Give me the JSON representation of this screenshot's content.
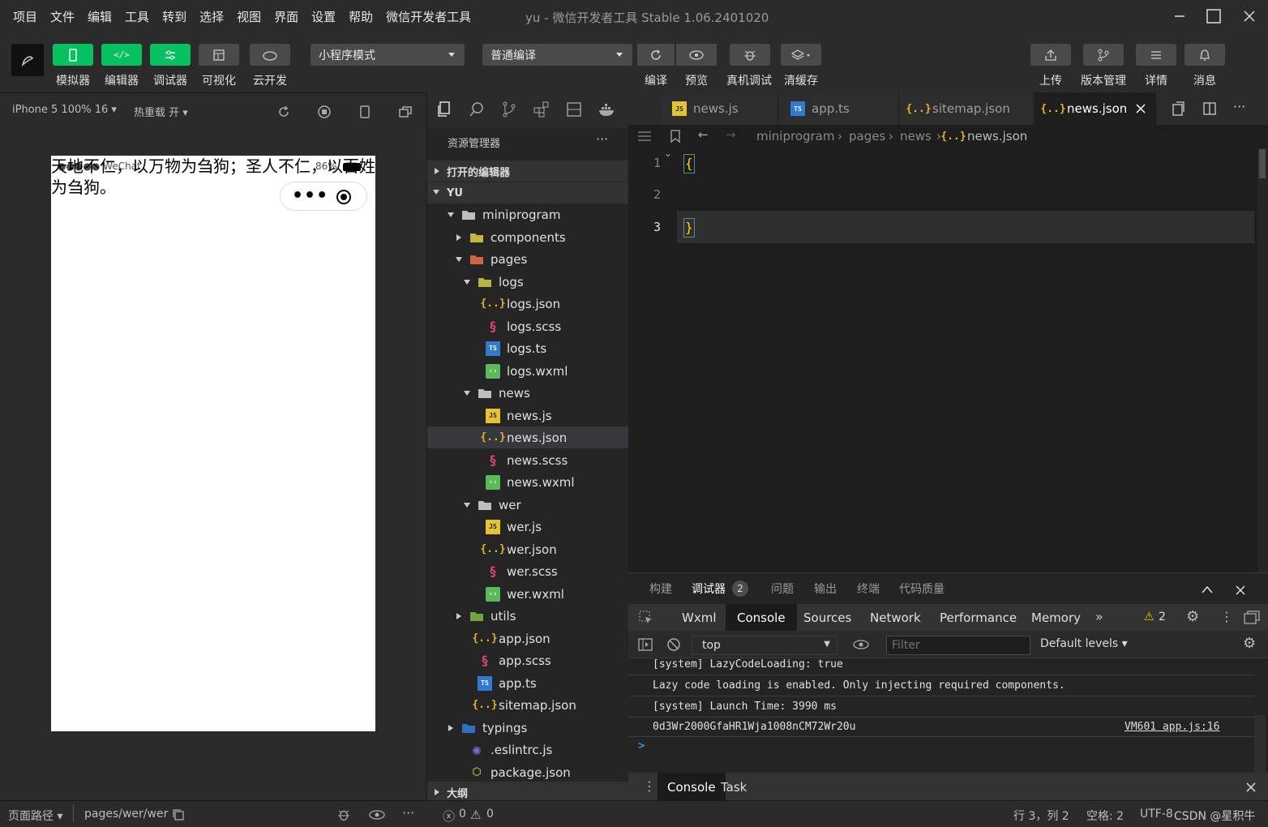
{
  "menubar": {
    "items": [
      "项目",
      "文件",
      "编辑",
      "工具",
      "转到",
      "选择",
      "视图",
      "界面",
      "设置",
      "帮助",
      "微信开发者工具"
    ],
    "window_title": "yu - 微信开发者工具 Stable 1.06.2401020"
  },
  "toolbar": {
    "simulator": "模拟器",
    "editor": "编辑器",
    "debugger": "调试器",
    "visual": "可视化",
    "cloud": "云开发",
    "mode_select": "小程序模式",
    "compile_select": "普通编译",
    "compile": "编译",
    "preview": "预览",
    "device_debug": "真机调试",
    "clear_cache": "清缓存",
    "upload": "上传",
    "version": "版本管理",
    "details": "详情",
    "messages": "消息"
  },
  "simulator": {
    "device": "iPhone 5 100% 16 ▾",
    "hot_reload": "热重载 开 ▾",
    "status_left": "●●●●● WeChat",
    "status_time": "",
    "status_battery": "86%",
    "page_text": "天地不仁，以万物为刍狗；圣人不仁，以百姓为刍狗。"
  },
  "explorer": {
    "title": "资源管理器",
    "open_editors": "打开的编辑器",
    "project": "YU",
    "outline": "大纲",
    "tree": [
      {
        "name": "miniprogram",
        "type": "folder",
        "depth": 1,
        "open": true
      },
      {
        "name": "components",
        "type": "folder-c",
        "depth": 2,
        "open": false
      },
      {
        "name": "pages",
        "type": "folder-p",
        "depth": 2,
        "open": true
      },
      {
        "name": "logs",
        "type": "folder-l",
        "depth": 3,
        "open": true
      },
      {
        "name": "logs.json",
        "type": "json",
        "depth": 4
      },
      {
        "name": "logs.scss",
        "type": "scss",
        "depth": 4
      },
      {
        "name": "logs.ts",
        "type": "ts",
        "depth": 4
      },
      {
        "name": "logs.wxml",
        "type": "wxml",
        "depth": 4
      },
      {
        "name": "news",
        "type": "folder",
        "depth": 3,
        "open": true
      },
      {
        "name": "news.js",
        "type": "js",
        "depth": 4
      },
      {
        "name": "news.json",
        "type": "json",
        "depth": 4,
        "selected": true
      },
      {
        "name": "news.scss",
        "type": "scss",
        "depth": 4
      },
      {
        "name": "news.wxml",
        "type": "wxml",
        "depth": 4
      },
      {
        "name": "wer",
        "type": "folder",
        "depth": 3,
        "open": true
      },
      {
        "name": "wer.js",
        "type": "js",
        "depth": 4
      },
      {
        "name": "wer.json",
        "type": "json",
        "depth": 4
      },
      {
        "name": "wer.scss",
        "type": "scss",
        "depth": 4
      },
      {
        "name": "wer.wxml",
        "type": "wxml",
        "depth": 4
      },
      {
        "name": "utils",
        "type": "folder-u",
        "depth": 2,
        "open": false
      },
      {
        "name": "app.json",
        "type": "json",
        "depth": 3
      },
      {
        "name": "app.scss",
        "type": "scss",
        "depth": 3
      },
      {
        "name": "app.ts",
        "type": "ts",
        "depth": 3
      },
      {
        "name": "sitemap.json",
        "type": "json",
        "depth": 3
      },
      {
        "name": "typings",
        "type": "folder-t",
        "depth": 1,
        "open": false
      },
      {
        "name": ".eslintrc.js",
        "type": "eslint",
        "depth": 2
      },
      {
        "name": "package.json",
        "type": "pkg",
        "depth": 2
      }
    ]
  },
  "editor": {
    "tabs": [
      {
        "label": "news.js",
        "type": "js"
      },
      {
        "label": "app.ts",
        "type": "ts"
      },
      {
        "label": "sitemap.json",
        "type": "json"
      },
      {
        "label": "news.json",
        "type": "json",
        "active": true
      }
    ],
    "breadcrumb": [
      "miniprogram",
      "pages",
      "news",
      "news.json"
    ],
    "lines": [
      {
        "num": "1",
        "text": "{"
      },
      {
        "num": "2",
        "text": ""
      },
      {
        "num": "3",
        "text": "}"
      }
    ]
  },
  "panel": {
    "tabs": [
      "构建",
      "调试器",
      "问题",
      "输出",
      "终端",
      "代码质量"
    ],
    "debugger_badge": "2",
    "devtools_tabs": [
      "Wxml",
      "Console",
      "Sources",
      "Network",
      "Performance",
      "Memory"
    ],
    "more": "»",
    "warnings": "2",
    "context": "top",
    "filter_placeholder": "Filter",
    "levels": "Default levels ▾",
    "logs": [
      {
        "text": "[system] LazyCodeLoading: true",
        "source": ""
      },
      {
        "text": "Lazy code loading is enabled. Only injecting required components.",
        "source": ""
      },
      {
        "text": "[system] Launch Time: 3990 ms",
        "source": ""
      },
      {
        "text": "0d3Wr2000GfaHR1Wja1008nCM72Wr20u",
        "source": "VM601 app.js:16"
      }
    ],
    "prompt": ">",
    "drawer_tabs": [
      "Console",
      "Task"
    ]
  },
  "statusbar": {
    "page_path_label": "页面路径 ▾",
    "page_path": "pages/wer/wer",
    "errors": "0",
    "warnings": "0",
    "position": "行 3，列 2",
    "spaces": "空格: 2",
    "encoding": "UTF-8",
    "watermark": "CSDN @星积牛"
  },
  "colors": {
    "accent": "#07c160",
    "background": "#1e1e1e",
    "panel": "#2b2b2b"
  }
}
